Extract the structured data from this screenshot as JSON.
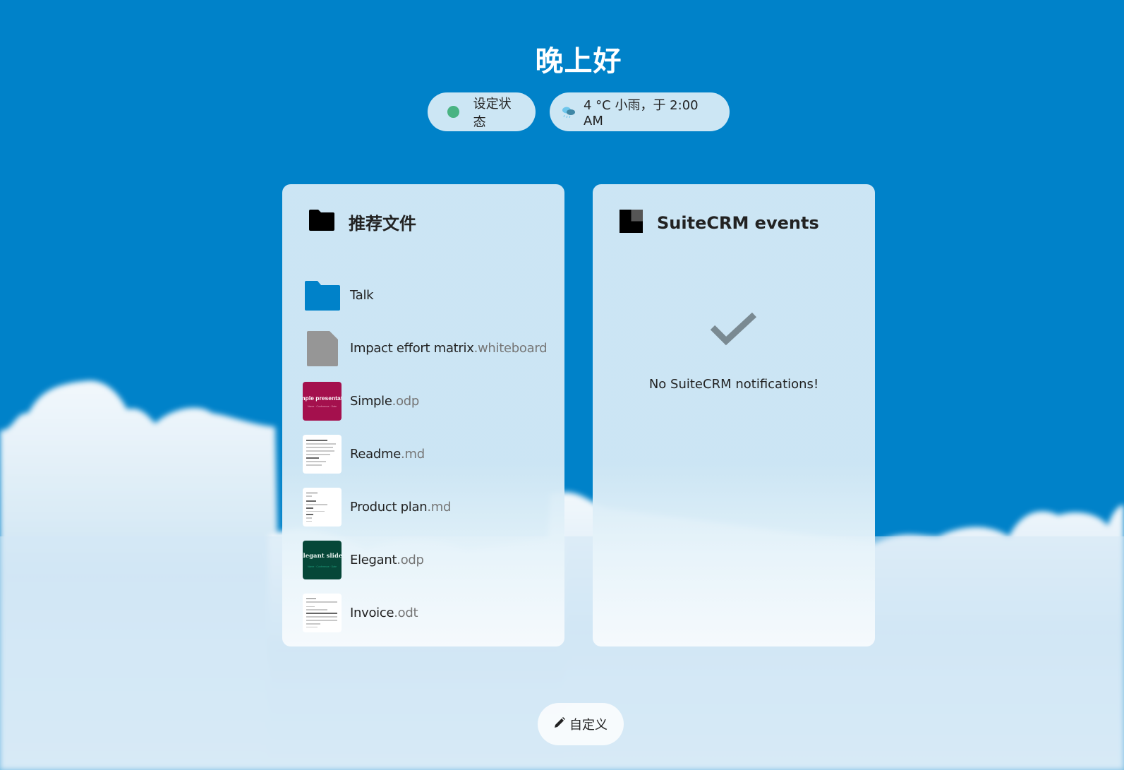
{
  "greeting": "晚上好",
  "status": {
    "label": "设定状态",
    "color": "#49b382"
  },
  "weather": {
    "icon": "cloud-rain-icon",
    "text": "4 °C 小雨，于 2:00 AM"
  },
  "panels": {
    "recommended_files": {
      "title": "推荐文件",
      "icon": "folder-icon",
      "items": [
        {
          "base": "Talk",
          "ext": "",
          "type": "folder"
        },
        {
          "base": "Impact effort matrix",
          "ext": ".whiteboard",
          "type": "generic-file"
        },
        {
          "base": "Simple",
          "ext": ".odp",
          "type": "presentation-simple",
          "thumb_text": "mple presentati",
          "thumb_sub": "Name · Conference · Date"
        },
        {
          "base": "Readme",
          "ext": ".md",
          "type": "document"
        },
        {
          "base": "Product plan",
          "ext": ".md",
          "type": "document"
        },
        {
          "base": "Elegant",
          "ext": ".odp",
          "type": "presentation-elegant",
          "thumb_text": "Elegant slides",
          "thumb_sub": "Name · Conference · Date"
        },
        {
          "base": "Invoice",
          "ext": ".odt",
          "type": "document"
        }
      ]
    },
    "suitecrm": {
      "title": "SuiteCRM events",
      "icon": "suitecrm-logo-icon",
      "empty_icon": "checkmark-icon",
      "empty_text": "No SuiteCRM notifications!"
    }
  },
  "customize": {
    "label": "自定义",
    "icon": "pencil-icon"
  },
  "colors": {
    "background": "#0082c9",
    "folder": "#0082c9",
    "checkmark": "#7a8a92"
  }
}
